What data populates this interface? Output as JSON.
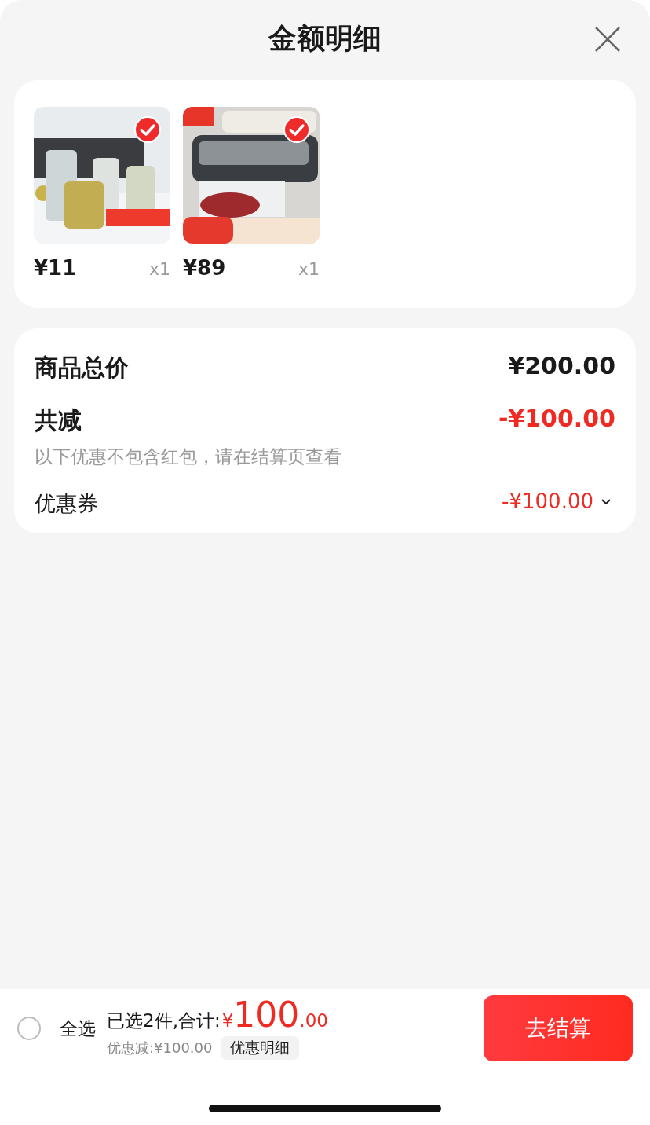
{
  "title": "金额明细",
  "products": [
    {
      "kind": "picture",
      "price": "¥11",
      "qty": "x1",
      "checked": true
    },
    {
      "kind": "picture",
      "price": "¥89",
      "qty": "x1",
      "checked": true
    }
  ],
  "summary": [
    {
      "kind": "total",
      "label": "商品总价",
      "value": "¥200.00"
    },
    {
      "kind": "reduction",
      "label": "共减",
      "value": "-¥100.00",
      "note": "以下优惠不包含红包，请在结算页查看"
    },
    {
      "kind": "coupon",
      "label": "优惠券",
      "value": "-¥100.00",
      "expanded": false
    }
  ],
  "bottom_bar": {
    "select_all": {
      "label": "全选",
      "checked": false
    },
    "selected_text": "已选2件,合计:",
    "currency": "¥",
    "total_int": "100",
    "total_dec": ".00",
    "discount": "优惠减:¥100.00",
    "detail_button": "优惠明细",
    "checkout_button": "去结算"
  }
}
